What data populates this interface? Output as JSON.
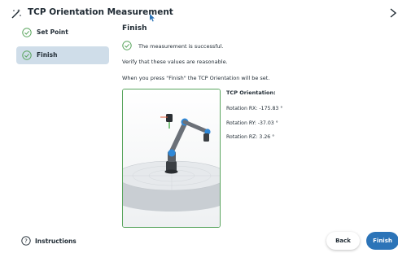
{
  "header": {
    "title": "TCP Orientation Measurement",
    "wand_icon": "magic-wand-icon",
    "close_icon": "chevron-right-icon"
  },
  "sidebar": {
    "items": [
      {
        "label": "Set Point",
        "icon": "check-circle-icon",
        "active": false
      },
      {
        "label": "Finish",
        "icon": "check-circle-icon",
        "active": true
      }
    ],
    "instructions_label": "Instructions",
    "instructions_icon": "help-circle-icon"
  },
  "main": {
    "heading": "Finish",
    "success_message": "The measurement is successful.",
    "verify_text": "Verify that these values are reasonable.",
    "press_text": "When you press \"Finish\" the TCP Orientation will be set."
  },
  "orientation": {
    "title": "TCP Orientation:",
    "rx": "Rotation RX: -175.83 °",
    "ry": "Rotation RY: -37.03 °",
    "rz": "Rotation RZ: 3.26 °"
  },
  "buttons": {
    "back": "Back",
    "finish": "Finish"
  },
  "colors": {
    "accent": "#2c74b8",
    "success": "#5aa55e",
    "active_item": "#cfdde9"
  }
}
